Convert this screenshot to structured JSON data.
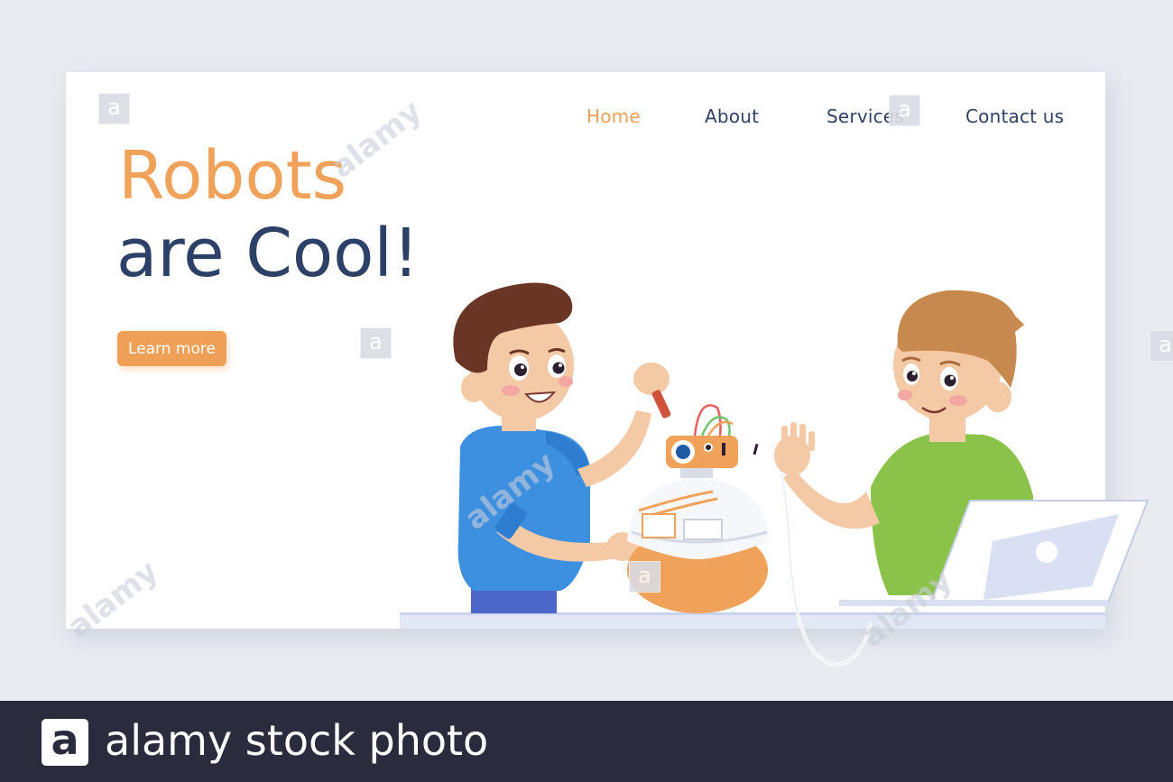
{
  "nav": {
    "items": [
      {
        "label": "Home",
        "active": true
      },
      {
        "label": "About",
        "active": false
      },
      {
        "label": "Services",
        "active": false
      },
      {
        "label": "Contact us",
        "active": false
      }
    ]
  },
  "hero": {
    "title_line1": "Robots",
    "title_line2": "are Cool!",
    "cta_label": "Learn more"
  },
  "colors": {
    "accent": "#f0a056",
    "navy": "#2c4068",
    "background": "#e9ebf0",
    "footer": "#2a2c3e"
  },
  "watermark": {
    "tile_letter": "a",
    "text": "alamy"
  },
  "footer": {
    "logo_letter": "a",
    "text": "alamy stock photo"
  }
}
